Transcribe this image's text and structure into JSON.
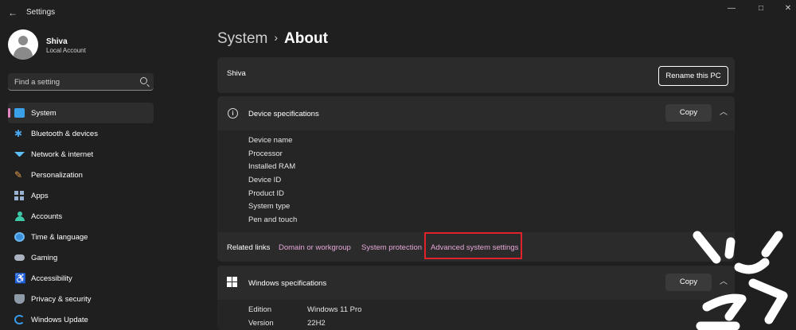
{
  "window": {
    "title": "Settings",
    "back_glyph": "←",
    "min_glyph": "—",
    "max_glyph": "□",
    "close_glyph": "✕"
  },
  "profile": {
    "name": "Shiva",
    "account_type": "Local Account"
  },
  "search": {
    "placeholder": "Find a setting"
  },
  "sidebar": {
    "items": [
      {
        "label": "System",
        "icon": "monitor-icon",
        "active": true
      },
      {
        "label": "Bluetooth & devices",
        "icon": "bluetooth-icon"
      },
      {
        "label": "Network & internet",
        "icon": "wifi-icon"
      },
      {
        "label": "Personalization",
        "icon": "brush-icon"
      },
      {
        "label": "Apps",
        "icon": "apps-icon"
      },
      {
        "label": "Accounts",
        "icon": "person-icon"
      },
      {
        "label": "Time & language",
        "icon": "globe-clock-icon"
      },
      {
        "label": "Gaming",
        "icon": "gamepad-icon"
      },
      {
        "label": "Accessibility",
        "icon": "accessibility-icon"
      },
      {
        "label": "Privacy & security",
        "icon": "shield-icon"
      },
      {
        "label": "Windows Update",
        "icon": "refresh-icon"
      }
    ],
    "accent_color": "#e586c4"
  },
  "header": {
    "parent": "System",
    "separator": "›",
    "current": "About"
  },
  "pc_card": {
    "name": "Shiva",
    "rename_label": "Rename this PC"
  },
  "device_specs": {
    "title": "Device specifications",
    "copy_label": "Copy",
    "rows": [
      "Device name",
      "Processor",
      "Installed RAM",
      "Device ID",
      "Product ID",
      "System type",
      "Pen and touch"
    ]
  },
  "related_links": {
    "label": "Related links",
    "links": [
      "Domain or workgroup",
      "System protection",
      "Advanced system settings"
    ],
    "link_color": "#e6a8d8",
    "highlight_color": "#e0222a"
  },
  "windows_specs": {
    "title": "Windows specifications",
    "copy_label": "Copy",
    "rows": [
      {
        "label": "Edition",
        "value": "Windows 11 Pro"
      },
      {
        "label": "Version",
        "value": "22H2"
      }
    ]
  }
}
